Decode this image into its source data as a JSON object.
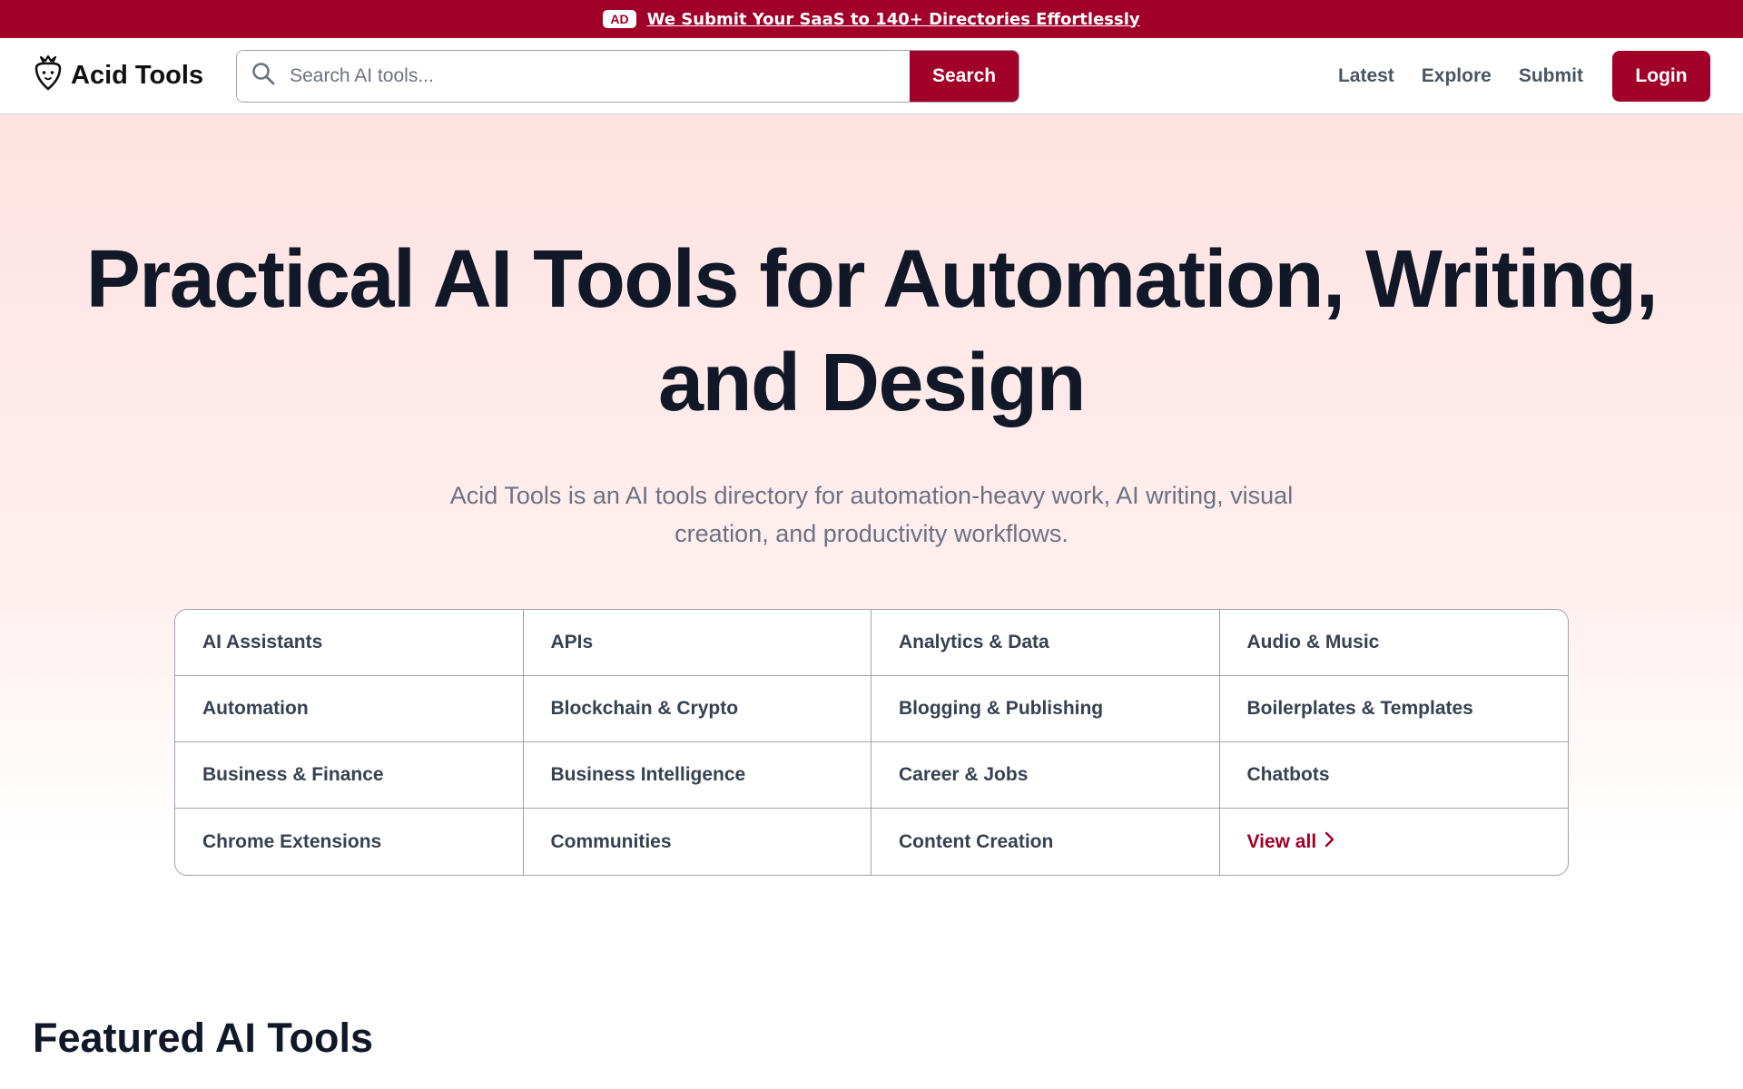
{
  "ad_bar": {
    "badge": "AD",
    "link_text": "We Submit Your SaaS to 140+ Directories Effortlessly"
  },
  "header": {
    "logo_text": "Acid Tools",
    "logo_icon": "strawberry-icon",
    "search_placeholder": "Search AI tools...",
    "search_button": "Search",
    "nav": [
      "Latest",
      "Explore",
      "Submit"
    ],
    "login_button": "Login"
  },
  "hero": {
    "title": "Practical AI Tools for Automation, Writing, and Design",
    "subtitle": "Acid Tools is an AI tools directory for automation-heavy work, AI writing, visual creation, and productivity workflows."
  },
  "categories": [
    "AI Assistants",
    "APIs",
    "Analytics & Data",
    "Audio & Music",
    "Automation",
    "Blockchain & Crypto",
    "Blogging & Publishing",
    "Boilerplates & Templates",
    "Business & Finance",
    "Business Intelligence",
    "Career & Jobs",
    "Chatbots",
    "Chrome Extensions",
    "Communities",
    "Content Creation"
  ],
  "view_all": "View all",
  "featured_heading": "Featured AI Tools",
  "colors": {
    "brand": "#a10028",
    "text_dark": "#111827",
    "text_muted": "#6b7280"
  }
}
